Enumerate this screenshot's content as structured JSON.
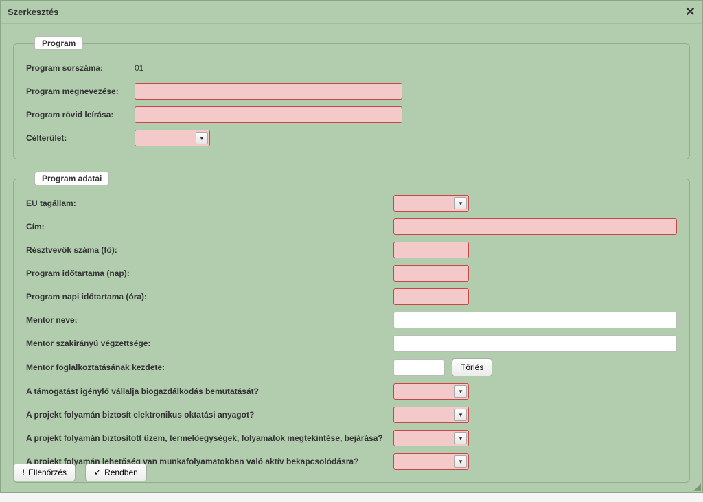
{
  "dialog": {
    "title": "Szerkesztés"
  },
  "section_program": {
    "legend": "Program",
    "sorszam_label": "Program sorszáma:",
    "sorszam_value": "01",
    "megnevezes_label": "Program megnevezése:",
    "megnevezes_value": "",
    "leiras_label": "Program rövid leírása:",
    "leiras_value": "",
    "celterulet_label": "Célterület:",
    "celterulet_value": ""
  },
  "section_adatai": {
    "legend": "Program adatai",
    "eu_label": "EU tagállam:",
    "eu_value": "",
    "cim_label": "Cím:",
    "cim_value": "",
    "resztvevok_label": "Résztvevők száma (fő):",
    "resztvevok_value": "",
    "idotartam_nap_label": "Program időtartama (nap):",
    "idotartam_nap_value": "",
    "idotartam_ora_label": "Program napi időtartama (óra):",
    "idotartam_ora_value": "",
    "mentor_neve_label": "Mentor neve:",
    "mentor_neve_value": "",
    "mentor_vegzettseg_label": "Mentor szakirányú végzettsége:",
    "mentor_vegzettseg_value": "",
    "mentor_kezdet_label": "Mentor foglalkoztatásának kezdete:",
    "mentor_kezdet_value": "",
    "torles_label": "Törlés",
    "q_bio_label": "A támogatást igénylő vállalja biogazdálkodás bemutatását?",
    "q_bio_value": "",
    "q_elearn_label": "A projekt folyamán biztosít elektronikus oktatási anyagot?",
    "q_elearn_value": "",
    "q_uzem_label": "A projekt folyamán biztosított üzem, termelőegységek, folyamatok megtekintése, bejárása?",
    "q_uzem_value": "",
    "q_munka_label": "A projekt folyamán lehetőség van munkafolyamatokban való aktív bekapcsolódásra?",
    "q_munka_value": ""
  },
  "footer": {
    "ellenorzes": "Ellenőrzés",
    "rendben": "Rendben"
  }
}
